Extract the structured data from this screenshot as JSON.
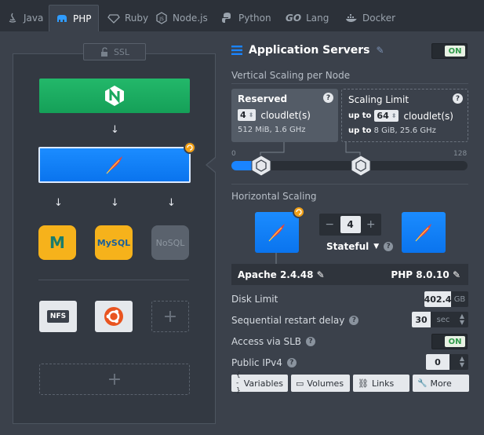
{
  "tabs": [
    {
      "label": "Java",
      "icon": "java-icon"
    },
    {
      "label": "PHP",
      "icon": "php-elephant-icon",
      "active": true
    },
    {
      "label": "Ruby",
      "icon": "ruby-icon"
    },
    {
      "label": "Node.js",
      "icon": "nodejs-icon"
    },
    {
      "label": "Python",
      "icon": "python-icon"
    },
    {
      "label": "Lang",
      "prefix": "GO",
      "icon": "go-icon"
    },
    {
      "label": "Docker",
      "icon": "docker-icon"
    }
  ],
  "topology": {
    "ssl_label": "SSL",
    "databases": [
      {
        "name": "mariadb",
        "label": "M"
      },
      {
        "name": "mysql",
        "label": "MySQL"
      },
      {
        "name": "nosql",
        "label": "NoSQL"
      }
    ],
    "storage": {
      "label": "NFS"
    }
  },
  "app_servers": {
    "title": "Application Servers",
    "toggle": "ON",
    "vertical_scaling_label": "Vertical Scaling per Node",
    "reserved": {
      "title": "Reserved",
      "value": "4",
      "unit": "cloudlet(s)",
      "specs": "512 MiB, 1.6 GHz"
    },
    "limit": {
      "title": "Scaling Limit",
      "prefix": "up to",
      "value": "64",
      "unit": "cloudlet(s)",
      "specs_prefix": "up to",
      "specs": "8 GiB, 25.6 GHz"
    },
    "slider": {
      "min": "0",
      "max": "128",
      "reserved": 4,
      "limit": 64
    },
    "horizontal_scaling_label": "Horizontal Scaling",
    "node_count": "4",
    "minus": "−",
    "plus": "+",
    "mode": "Stateful",
    "server_version": "Apache 2.4.48",
    "php_version": "PHP 8.0.10",
    "disk_limit": {
      "label": "Disk Limit",
      "value": "402.4",
      "unit": "GB"
    },
    "restart_delay": {
      "label": "Sequential restart delay",
      "value": "30",
      "unit": "sec"
    },
    "slb": {
      "label": "Access via SLB",
      "toggle": "ON"
    },
    "ipv4": {
      "label": "Public IPv4",
      "value": "0"
    },
    "buttons": [
      {
        "label": "Variables",
        "icon": "braces-icon",
        "glyph": "{ - }"
      },
      {
        "label": "Volumes",
        "icon": "folder-icon",
        "glyph": "▭"
      },
      {
        "label": "Links",
        "icon": "link-icon",
        "glyph": "⛓"
      },
      {
        "label": "More",
        "icon": "wrench-icon",
        "glyph": "🔧"
      }
    ]
  },
  "colors": {
    "accent": "#1a84ff",
    "nginx": "#1aa85f",
    "on": "#2f9b4a",
    "badge": "#f2a117"
  }
}
